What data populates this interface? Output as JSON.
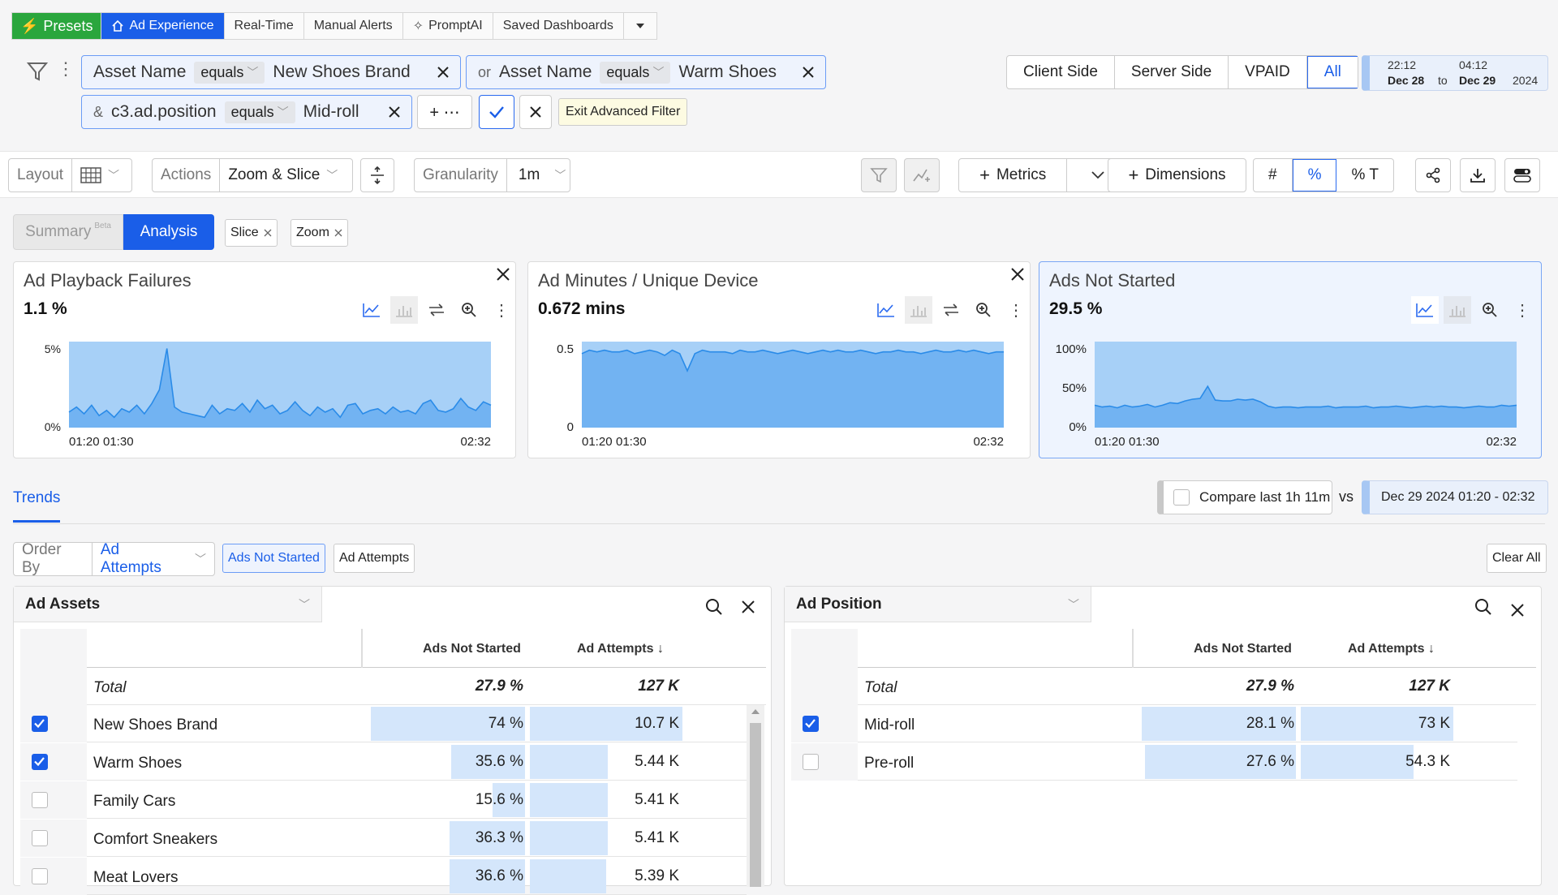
{
  "nav": {
    "presets": "Presets",
    "items": [
      "Ad Experience",
      "Real-Time",
      "Manual Alerts",
      "PromptAI",
      "Saved Dashboards"
    ]
  },
  "filters": {
    "f1": {
      "field": "Asset Name",
      "op": "equals",
      "value": "New Shoes Brand"
    },
    "f2": {
      "prefix": "or",
      "field": "Asset Name",
      "op": "equals",
      "value": "Warm Shoes"
    },
    "f3": {
      "prefix": "&",
      "field": "c3.ad.position",
      "op": "equals",
      "value": "Mid-roll"
    },
    "add": "+ ⋯",
    "exit": "Exit Advanced Filter"
  },
  "side_toggle": {
    "options": [
      "Client Side",
      "Server Side",
      "VPAID",
      "All"
    ],
    "selected": "All"
  },
  "date_range": {
    "start_time": "22:12",
    "start_date": "Dec 28",
    "to": "to",
    "end_time": "04:12",
    "end_date": "Dec 29",
    "year": "2024"
  },
  "toolbar": {
    "layout": "Layout",
    "actions_label": "Actions",
    "actions_value": "Zoom & Slice",
    "granularity_label": "Granularity",
    "granularity_value": "1m",
    "metrics": "Metrics",
    "dimensions": "Dimensions",
    "hash": "#",
    "pct": "%",
    "pct_t": "% T"
  },
  "view_tabs": {
    "summary": "Summary",
    "beta": "Beta",
    "analysis": "Analysis",
    "slice": "Slice",
    "zoom": "Zoom"
  },
  "cards": [
    {
      "title": "Ad Playback Failures",
      "value": "1.1 %",
      "ytop": "5%",
      "ybot": "0%",
      "x1": "01:20",
      "x2": "01:30",
      "x3": "02:32"
    },
    {
      "title": "Ad Minutes / Unique Device",
      "value": "0.672 mins",
      "ytop": "0.5",
      "ybot": "0",
      "x1": "01:20",
      "x2": "01:30",
      "x3": "02:32"
    },
    {
      "title": "Ads Not Started",
      "value": "29.5 %",
      "ytop": "100%",
      "ymid": "50%",
      "ybot": "0%",
      "x1": "01:20",
      "x2": "01:30",
      "x3": "02:32"
    }
  ],
  "chart_data": [
    {
      "type": "area",
      "title": "Ad Playback Failures",
      "ylim": [
        0,
        5
      ],
      "x_start": "01:20",
      "x_end": "02:32",
      "values": [
        0.9,
        1.2,
        0.8,
        1.3,
        0.7,
        1.0,
        0.6,
        1.1,
        0.9,
        1.3,
        0.8,
        1.4,
        2.2,
        4.6,
        1.2,
        0.9,
        0.8,
        0.7,
        0.6,
        1.3,
        0.8,
        1.1,
        1.0,
        1.4,
        0.9,
        1.6,
        1.1,
        1.3,
        0.8,
        1.0,
        1.5,
        1.0,
        0.7,
        1.2,
        0.9,
        1.1,
        0.6,
        1.3,
        1.4,
        0.8,
        1.0,
        1.1,
        0.8,
        1.2,
        0.9,
        1.0,
        0.8,
        1.4,
        1.6,
        1.0,
        0.9,
        1.1,
        1.7,
        1.2,
        1.0,
        1.5,
        1.3
      ]
    },
    {
      "type": "area",
      "title": "Ad Minutes / Unique Device",
      "ylim": [
        0,
        0.5
      ],
      "x_start": "01:20",
      "x_end": "02:32",
      "values": [
        0.43,
        0.45,
        0.44,
        0.45,
        0.44,
        0.44,
        0.45,
        0.43,
        0.44,
        0.45,
        0.44,
        0.42,
        0.45,
        0.43,
        0.33,
        0.43,
        0.45,
        0.44,
        0.44,
        0.44,
        0.43,
        0.45,
        0.44,
        0.44,
        0.45,
        0.44,
        0.43,
        0.44,
        0.45,
        0.44,
        0.43,
        0.44,
        0.45,
        0.44,
        0.45,
        0.44,
        0.44,
        0.45,
        0.44,
        0.43,
        0.44,
        0.44,
        0.45,
        0.44,
        0.44,
        0.43,
        0.44,
        0.45,
        0.44,
        0.44,
        0.45,
        0.44,
        0.45,
        0.44,
        0.43,
        0.44,
        0.44
      ]
    },
    {
      "type": "area",
      "title": "Ads Not Started",
      "ylim": [
        0,
        100
      ],
      "x_start": "01:20",
      "x_end": "02:32",
      "values": [
        26,
        24,
        25,
        23,
        26,
        24,
        25,
        27,
        24,
        26,
        29,
        28,
        31,
        33,
        34,
        48,
        32,
        31,
        31,
        33,
        32,
        33,
        30,
        25,
        23,
        24,
        24,
        23,
        24,
        24,
        24,
        25,
        23,
        24,
        24,
        24,
        25,
        23,
        24,
        24,
        25,
        24,
        23,
        24,
        25,
        24,
        25,
        24,
        24,
        23,
        24,
        25,
        24,
        24,
        26,
        25,
        26
      ]
    }
  ],
  "trends": {
    "tab": "Trends",
    "compare_label": "Compare last 1h 11m",
    "vs": "vs",
    "compare_range": "Dec 29 2024 01:20 - 02:32",
    "order_by_label": "Order By",
    "order_by_value": "Ad Attempts",
    "tag_ans": "Ads Not Started",
    "tag_aa": "Ad Attempts",
    "clear_all": "Clear All"
  },
  "assets_table": {
    "title": "Ad Assets",
    "col1": "Ads Not Started",
    "col2": "Ad Attempts",
    "total": {
      "name": "Total",
      "ans": "27.9 %",
      "aa": "127 K"
    },
    "rows": [
      {
        "name": "New Shoes Brand",
        "ans": "74 %",
        "aa": "10.7 K",
        "checked": true,
        "ans_frac": 1.0,
        "aa_frac": 1.0
      },
      {
        "name": "Warm Shoes",
        "ans": "35.6 %",
        "aa": "5.44 K",
        "checked": true,
        "ans_frac": 0.48,
        "aa_frac": 0.51
      },
      {
        "name": "Family Cars",
        "ans": "15.6 %",
        "aa": "5.41 K",
        "checked": false,
        "ans_frac": 0.21,
        "aa_frac": 0.51
      },
      {
        "name": "Comfort Sneakers",
        "ans": "36.3 %",
        "aa": "5.41 K",
        "checked": false,
        "ans_frac": 0.49,
        "aa_frac": 0.51
      },
      {
        "name": "Meat Lovers",
        "ans": "36.6 %",
        "aa": "5.39 K",
        "checked": false,
        "ans_frac": 0.49,
        "aa_frac": 0.5
      }
    ]
  },
  "position_table": {
    "title": "Ad Position",
    "col1": "Ads Not Started",
    "col2": "Ad Attempts",
    "total": {
      "name": "Total",
      "ans": "27.9 %",
      "aa": "127 K"
    },
    "rows": [
      {
        "name": "Mid-roll",
        "ans": "28.1 %",
        "aa": "73 K",
        "checked": true,
        "ans_frac": 1.0,
        "aa_frac": 1.0
      },
      {
        "name": "Pre-roll",
        "ans": "27.6 %",
        "aa": "54.3 K",
        "checked": false,
        "ans_frac": 0.98,
        "aa_frac": 0.74
      }
    ]
  }
}
